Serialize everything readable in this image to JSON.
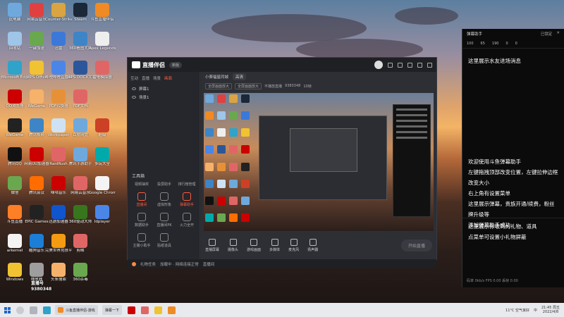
{
  "desktop": {
    "icons": [
      {
        "label": "此电脑",
        "color": "#6fa8dc",
        "col": 0,
        "row": 0
      },
      {
        "label": "网易云音乐",
        "color": "#e04040",
        "col": 1,
        "row": 0
      },
      {
        "label": "Counter-Strike: Global Offensive",
        "color": "#d9a441",
        "col": 2,
        "row": 0
      },
      {
        "label": "Steam",
        "color": "#1b2838",
        "col": 3,
        "row": 0
      },
      {
        "label": "斗鱼直播伴侣",
        "color": "#f08a24",
        "col": 4,
        "row": 0
      },
      {
        "label": "回收站",
        "color": "#9fc5e8",
        "col": 0,
        "row": 1
      },
      {
        "label": "一键加速",
        "color": "#6aa84f",
        "col": 1,
        "row": 1
      },
      {
        "label": "迅雷",
        "color": "#3c78d8",
        "col": 2,
        "row": 1
      },
      {
        "label": "360看图大师",
        "color": "#3d85c6",
        "col": 3,
        "row": 1
      },
      {
        "label": "Apex Legends",
        "color": "#eeeeee",
        "col": 4,
        "row": 1
      },
      {
        "label": "Microsoft Edge",
        "color": "#2fa3c9",
        "col": 0,
        "row": 2
      },
      {
        "label": "WPS Office",
        "color": "#f1c232",
        "col": 1,
        "row": 2
      },
      {
        "label": "哔哩哔哩直播姬",
        "color": "#4a86e8",
        "col": 2,
        "row": 2
      },
      {
        "label": "WPS DOCX文档",
        "color": "#2b579a",
        "col": 3,
        "row": 2
      },
      {
        "label": "雷电模拟器",
        "color": "#e06666",
        "col": 4,
        "row": 2
      },
      {
        "label": "QQ浏览器",
        "color": "#cc0000",
        "col": 0,
        "row": 3
      },
      {
        "label": "WeGame",
        "color": "#f6b26b",
        "col": 1,
        "row": 3
      },
      {
        "label": "PDF转换器",
        "color": "#e69138",
        "col": 2,
        "row": 3
      },
      {
        "label": "PDF文档",
        "color": "#e06666",
        "col": 3,
        "row": 3
      },
      {
        "label": "WeGame",
        "color": "#222222",
        "col": 0,
        "row": 4
      },
      {
        "label": "腾讯视频",
        "color": "#3d85c6",
        "col": 1,
        "row": 4
      },
      {
        "label": "Workpaper",
        "color": "#cfe2f3",
        "col": 2,
        "row": 4
      },
      {
        "label": "百度网盘",
        "color": "#6fa8dc",
        "col": 3,
        "row": 4
      },
      {
        "label": "超级",
        "color": "#cc4125",
        "col": 4,
        "row": 4
      },
      {
        "label": "腾讯QQ",
        "color": "#111111",
        "col": 0,
        "row": 5
      },
      {
        "label": "网易UU加速器",
        "color": "#cc0000",
        "col": 1,
        "row": 5
      },
      {
        "label": "RaidRush",
        "color": "#e06666",
        "col": 2,
        "row": 5
      },
      {
        "label": "腾讯手游助手",
        "color": "#6fa8dc",
        "col": 3,
        "row": 5
      },
      {
        "label": "多玩大全",
        "color": "#00aaaa",
        "col": 4,
        "row": 5
      },
      {
        "label": "微信",
        "color": "#6aa84f",
        "col": 0,
        "row": 6
      },
      {
        "label": "腾讯会议",
        "color": "#ff6d01",
        "col": 1,
        "row": 6
      },
      {
        "label": "咪咕音乐",
        "color": "#cc0000",
        "col": 2,
        "row": 6
      },
      {
        "label": "网易云音乐",
        "color": "#e06666",
        "col": 3,
        "row": 6
      },
      {
        "label": "Google Chrome",
        "color": "#f4f4f4",
        "col": 4,
        "row": 6
      },
      {
        "label": "斗鱼直播",
        "color": "#ff7f27",
        "col": 0,
        "row": 7
      },
      {
        "label": "EPIC Games",
        "color": "#222222",
        "col": 1,
        "row": 7
      },
      {
        "label": "迅游加速器",
        "color": "#1155cc",
        "col": 2,
        "row": 7
      },
      {
        "label": "360驱动大师",
        "color": "#38761d",
        "col": 3,
        "row": 7
      },
      {
        "label": "Idplayer",
        "color": "#4a86e8",
        "col": 4,
        "row": 7
      },
      {
        "label": "arkernel",
        "color": "#f3f3f3",
        "col": 0,
        "row": 8
      },
      {
        "label": "酷狗音乐",
        "color": "#1c7ed6",
        "col": 1,
        "row": 8
      },
      {
        "label": "完美世界竞技平台",
        "color": "#f39c12",
        "col": 2,
        "row": 8
      },
      {
        "label": "剪映",
        "color": "#e06666",
        "col": 3,
        "row": 8
      },
      {
        "label": "Windows",
        "color": "#f1c232",
        "col": 0,
        "row": 9
      },
      {
        "label": "播放器",
        "color": "#9e9e9e",
        "col": 1,
        "row": 9
      },
      {
        "label": "头条搜索",
        "color": "#f6b26b",
        "col": 2,
        "row": 9
      },
      {
        "label": "360杀毒",
        "color": "#6aa84f",
        "col": 3,
        "row": 9
      }
    ],
    "room_badge": [
      "直播号",
      "9380348"
    ]
  },
  "app": {
    "title": "直播伴侣",
    "version": "新版",
    "tabs": [
      "互动",
      "直播",
      "场景",
      "画面"
    ],
    "scenes": [
      "屏幕1",
      "场景1"
    ],
    "toolbox_title": "工具箱",
    "tools_row0": [
      "视频抽奖",
      "投屏助手",
      "排行榜管理"
    ],
    "tools": [
      {
        "label": "直播间",
        "red": true
      },
      {
        "label": "虚拟形象",
        "red": false
      },
      {
        "label": "弹幕助手",
        "red": true
      },
      {
        "label": "数据助手",
        "red": false
      },
      {
        "label": "直播间PK",
        "red": false
      },
      {
        "label": "火力全开",
        "red": false
      },
      {
        "label": "主播小助手",
        "red": false
      },
      {
        "label": "贴纸道具",
        "red": false
      }
    ],
    "stage_title": "小葵福星同城",
    "stage_badge": "高清",
    "stage_chips": [
      "全屏画面放大",
      "全屏画面放大"
    ],
    "stage_info": "不播放直播",
    "stage_count": "9380348",
    "stage_fps": "10帧",
    "bottom_buttons": [
      "直播屏幕",
      "摄像头",
      "游戏画面",
      "多媒体",
      "麦克风",
      "扬声器"
    ],
    "start_live": "开始直播",
    "status_items": [
      "礼物任务",
      "加载中 · 网络连接正常",
      "直播间"
    ]
  },
  "danmu": {
    "title": "弹幕助手",
    "head_right": [
      "已锁定",
      "✕"
    ],
    "stats": [
      "100",
      "65",
      "190",
      "0",
      "0"
    ],
    "sec1": [
      "这里展示水友进场消息"
    ],
    "sec2": [
      "欢迎使用斗鱼弹幕助手",
      "左键拖拽顶部改变位置，左键拉伸边框",
      "改变大小",
      "右上角有设置菜单",
      "这里展示弹幕，贵族开通/续费，粉丝",
      "牌升级等",
      "添加弹幕助手成功"
    ],
    "sec3": [
      "这里展示你收到的礼物、道具",
      "点菜单可设置小礼物屏蔽"
    ],
    "footer": "码率 0kb/s FPS 0.00 丢帧 0.00"
  },
  "taskbar": {
    "items": [
      "斗鱼直播伴侣-游戏",
      "弹幕一下"
    ],
    "weather": "11°C 空气良好",
    "time": "21:45 周五",
    "date": "2022/4/8",
    "lang": "中"
  }
}
